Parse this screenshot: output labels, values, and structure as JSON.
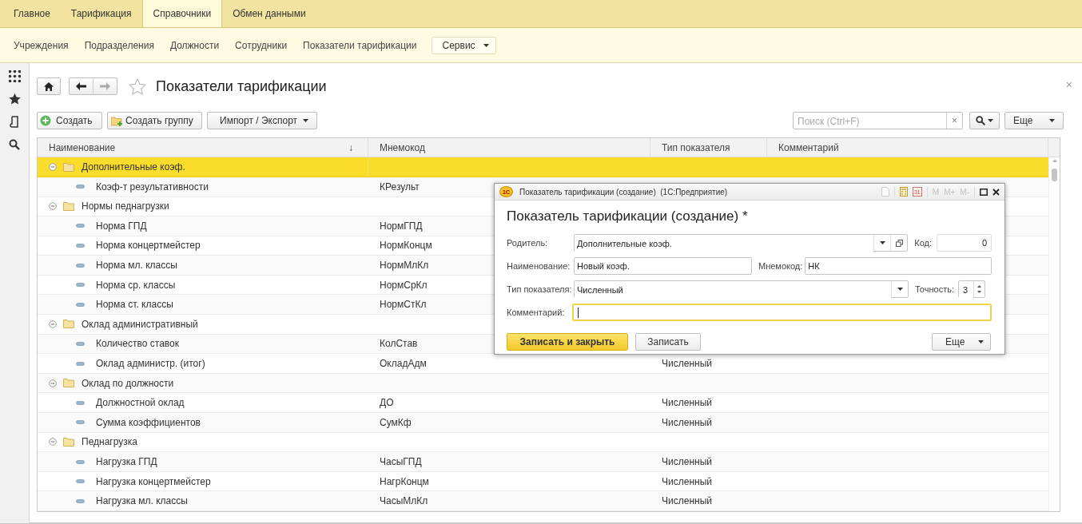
{
  "top_tabs": [
    {
      "label": "Главное",
      "selected": false
    },
    {
      "label": "Тарификация",
      "selected": false
    },
    {
      "label": "Справочники",
      "selected": true
    },
    {
      "label": "Обмен данными",
      "selected": false
    }
  ],
  "sub_nav": {
    "items": [
      "Учреждения",
      "Подразделения",
      "Должности",
      "Сотрудники",
      "Показатели тарификации"
    ],
    "service_button": "Сервис"
  },
  "page": {
    "title": "Показатели тарификации",
    "close": "×"
  },
  "toolbar": {
    "create": "Создать",
    "create_group": "Создать группу",
    "import_export": "Импорт / Экспорт",
    "search": {
      "placeholder": "Поиск (Ctrl+F)",
      "clear": "×"
    },
    "more": "Еще"
  },
  "table": {
    "columns": [
      {
        "label": "Наименование",
        "sort_mark": "↓"
      },
      {
        "label": "Мнемокод"
      },
      {
        "label": "Тип показателя"
      },
      {
        "label": "Комментарий"
      }
    ],
    "rows": [
      {
        "kind": "group",
        "name": "Дополнительные коэф.",
        "expanded": true,
        "selected": true,
        "children": [
          {
            "kind": "item",
            "name": "Коэф-т результативности",
            "mnemo": "КРезульт",
            "selected": false
          }
        ]
      },
      {
        "kind": "group",
        "name": "Нормы педнагрузки",
        "expanded": true,
        "selected": false,
        "children": [
          {
            "kind": "item",
            "name": "Норма ГПД",
            "mnemo": "НормГПД",
            "selected": false
          },
          {
            "kind": "item",
            "name": "Норма концертмейстер",
            "mnemo": "НормКонцм",
            "selected": false
          },
          {
            "kind": "item",
            "name": "Норма мл. классы",
            "mnemo": "НормМлКл",
            "selected": false
          },
          {
            "kind": "item",
            "name": "Норма ср. классы",
            "mnemo": "НормСрКл",
            "selected": false
          },
          {
            "kind": "item",
            "name": "Норма ст. классы",
            "mnemo": "НормСтКл",
            "selected": false
          }
        ]
      },
      {
        "kind": "group",
        "name": "Оклад административный",
        "expanded": true,
        "selected": false,
        "children": [
          {
            "kind": "item",
            "name": "Количество ставок",
            "mnemo": "КолСтав",
            "selected": false
          },
          {
            "kind": "item",
            "name": "Оклад администр. (итог)",
            "mnemo": "ОкладАдм",
            "type": "Численный",
            "selected": false
          }
        ]
      },
      {
        "kind": "group",
        "name": "Оклад по должности",
        "expanded": true,
        "selected": false,
        "children": [
          {
            "kind": "item",
            "name": "Должностной оклад",
            "mnemo": "ДО",
            "type": "Численный",
            "selected": false
          },
          {
            "kind": "item",
            "name": "Сумма коэффициентов",
            "mnemo": "СумКф",
            "type": "Численный",
            "selected": false
          }
        ]
      },
      {
        "kind": "group",
        "name": "Педнагрузка",
        "expanded": true,
        "selected": false,
        "children": [
          {
            "kind": "item",
            "name": "Нагрузка ГПД",
            "mnemo": "ЧасыГПД",
            "type": "Численный",
            "selected": false
          },
          {
            "kind": "item",
            "name": "Нагрузка концертмейстер",
            "mnemo": "НагрКонцм",
            "type": "Численный",
            "selected": false
          },
          {
            "kind": "item",
            "name": "Нагрузка мл. классы",
            "mnemo": "ЧасыМлКл",
            "type": "Численный",
            "selected": false
          }
        ]
      }
    ]
  },
  "dialog": {
    "logo": "1С",
    "title": "Показатель тарификации (создание)  (1С:Предприятие)",
    "calendar_day": "31",
    "memory_buttons": [
      {
        "label": "M",
        "disabled": true
      },
      {
        "label": "M+",
        "disabled": true
      },
      {
        "label": "M-",
        "disabled": true
      }
    ],
    "heading": "Показатель тарификации (создание) *",
    "fields": {
      "parent": {
        "label": "Родитель:",
        "value": "Дополнительные коэф."
      },
      "code": {
        "label": "Код:",
        "value": "0"
      },
      "name": {
        "label": "Наименование:",
        "value": "Новый коэф."
      },
      "mnemo": {
        "label": "Мнемокод:",
        "value": "НК"
      },
      "type": {
        "label": "Тип показателя:",
        "value": "Численный"
      },
      "precision": {
        "label": "Точность:",
        "value": "3"
      },
      "comment": {
        "label": "Комментарий:",
        "focused": true
      }
    },
    "buttons": {
      "save_close": "Записать и закрыть",
      "save": "Записать",
      "more": "Еще"
    }
  }
}
